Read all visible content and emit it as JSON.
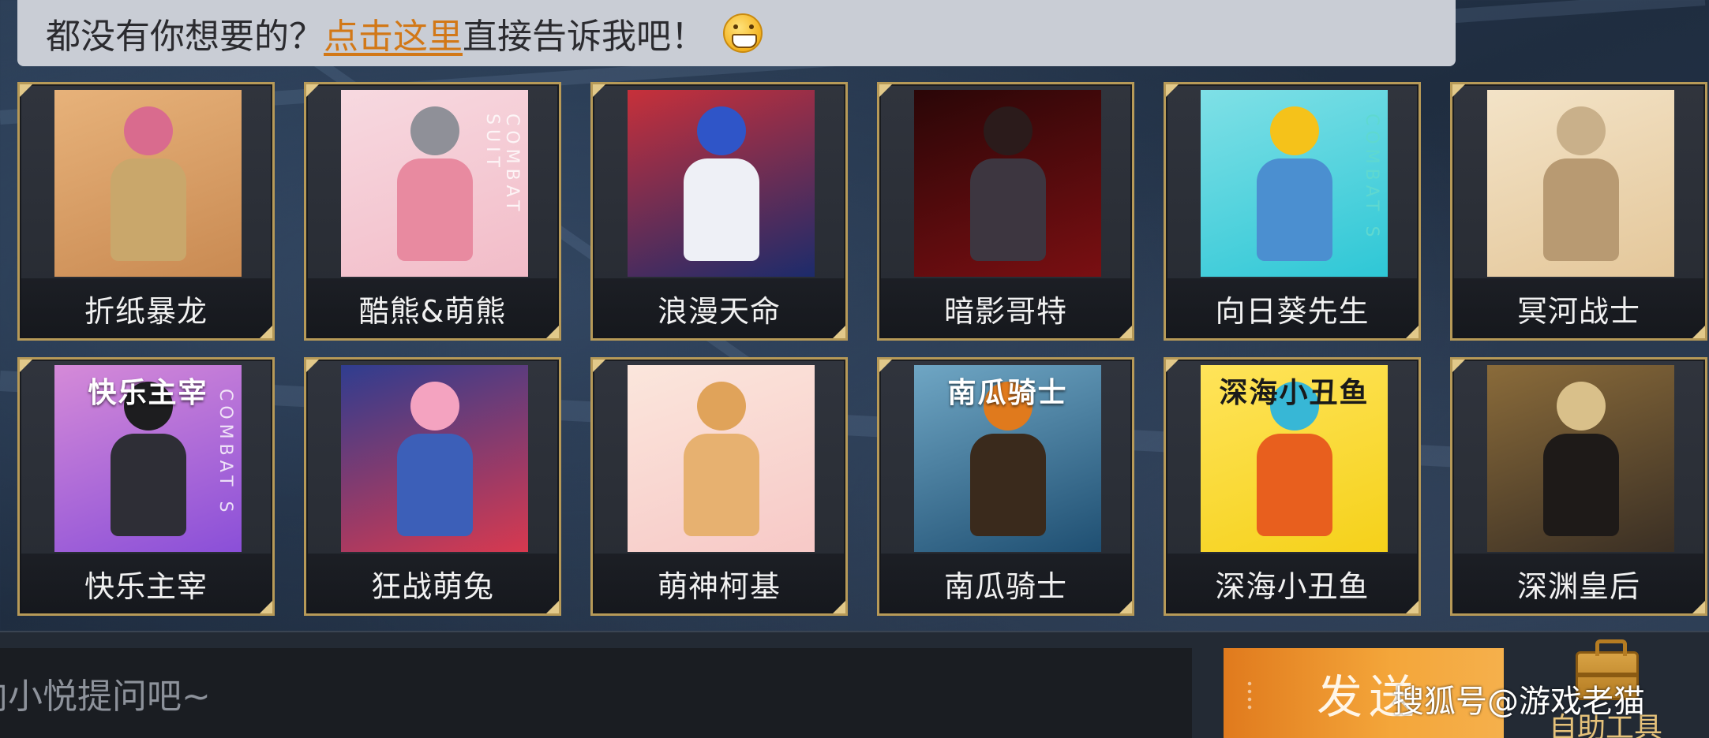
{
  "hint": {
    "prefix": "都没有你想要的？",
    "link": "点击这里",
    "suffix": "直接告诉我吧！",
    "emoji": "grinning-face-icon"
  },
  "skins": [
    {
      "name": "折纸暴龙",
      "overlay": "",
      "side": "",
      "colors": {
        "bg": "#c98a52",
        "bg2": "#e7b27a",
        "head": "#d96b8e",
        "body": "#c9a76b"
      }
    },
    {
      "name": "酷熊&萌熊",
      "overlay": "",
      "side": "COMBAT SUIT",
      "colors": {
        "bg": "#f2bcc8",
        "bg2": "#f7d9e0",
        "head": "#8f9098",
        "body": "#e88aa0"
      }
    },
    {
      "name": "浪漫天命",
      "overlay": "",
      "side": "",
      "colors": {
        "bg": "#1c2b6b",
        "bg2": "#c7303a",
        "head": "#2f55c8",
        "body": "#eef0f6"
      }
    },
    {
      "name": "暗影哥特",
      "overlay": "",
      "side": "",
      "colors": {
        "bg": "#7a0f12",
        "bg2": "#2a0607",
        "head": "#2b1b1b",
        "body": "#3d3640"
      }
    },
    {
      "name": "向日葵先生",
      "overlay": "",
      "side": "COMBAT S",
      "colors": {
        "bg": "#2ec7d6",
        "bg2": "#7fe0e6",
        "head": "#f5c21a",
        "body": "#4b8fd0"
      }
    },
    {
      "name": "冥河战士",
      "overlay": "",
      "side": "",
      "colors": {
        "bg": "#e4c79a",
        "bg2": "#f3e3c7",
        "head": "#c9b08a",
        "body": "#b89a72"
      }
    },
    {
      "name": "快乐主宰",
      "overlay": "快乐主宰",
      "side": "COMBAT S",
      "colors": {
        "bg": "#8a4fd8",
        "bg2": "#d58ad8",
        "head": "#1d1d1f",
        "body": "#2e2e36"
      }
    },
    {
      "name": "狂战萌兔",
      "overlay": "",
      "side": "",
      "colors": {
        "bg": "#d8394f",
        "bg2": "#2f3d8f",
        "head": "#f4a3c0",
        "body": "#3c5fb8"
      }
    },
    {
      "name": "萌神柯基",
      "overlay": "",
      "side": "",
      "colors": {
        "bg": "#f7c9c7",
        "bg2": "#fbe6dc",
        "head": "#e0a35a",
        "body": "#e7b170"
      }
    },
    {
      "name": "南瓜骑士",
      "overlay": "南瓜骑士",
      "side": "",
      "colors": {
        "bg": "#1f4f72",
        "bg2": "#6fa6c4",
        "head": "#e07a1d",
        "body": "#3a2a1c"
      }
    },
    {
      "name": "深海小丑鱼",
      "overlay": "深海小丑鱼",
      "side": "",
      "colors": {
        "bg": "#f5d11a",
        "bg2": "#ffe45a",
        "head": "#37b7d6",
        "body": "#e85f1e"
      }
    },
    {
      "name": "深渊皇后",
      "overlay": "",
      "side": "",
      "colors": {
        "bg": "#3a2f24",
        "bg2": "#8a6b3a",
        "head": "#d9c08a",
        "body": "#1e1a18"
      }
    }
  ],
  "chat": {
    "placeholder": "向小悦提问吧~",
    "send_label": "发送"
  },
  "toolbox": {
    "label": "自助工具",
    "icon": "toolbox-icon"
  },
  "watermark": "搜狐号@游戏老猫"
}
